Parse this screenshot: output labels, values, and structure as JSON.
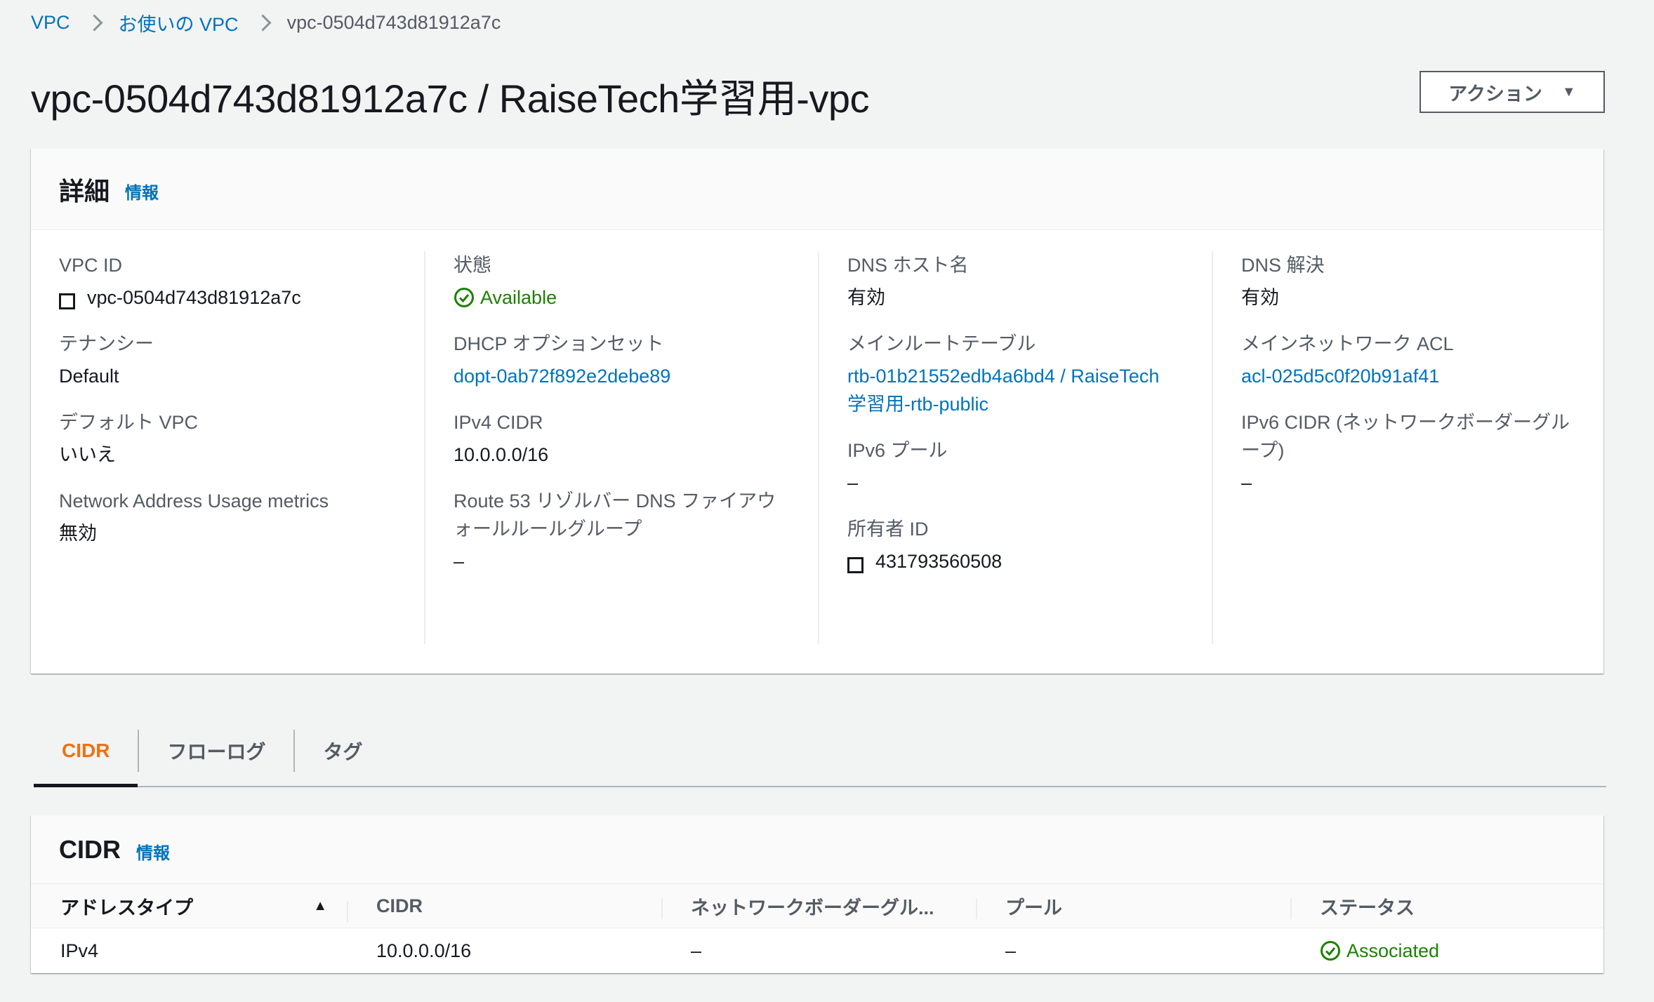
{
  "breadcrumb": {
    "items": [
      "VPC",
      "お使いの VPC"
    ],
    "current": "vpc-0504d743d81912a7c"
  },
  "page_title": "vpc-0504d743d81912a7c / RaiseTech学習用-vpc",
  "actions_button": {
    "label": "アクション",
    "caret": "▼"
  },
  "details": {
    "heading": "詳細",
    "info_link": "情報",
    "col1": {
      "vpc_id_label": "VPC ID",
      "vpc_id_value": "vpc-0504d743d81912a7c",
      "tenancy_label": "テナンシー",
      "tenancy_value": "Default",
      "default_vpc_label": "デフォルト VPC",
      "default_vpc_value": "いいえ",
      "nau_label": "Network Address Usage metrics",
      "nau_value": "無効"
    },
    "col2": {
      "state_label": "状態",
      "state_value": "Available",
      "dhcp_label": "DHCP オプションセット",
      "dhcp_value": "dopt-0ab72f892e2debe89",
      "ipv4_label": "IPv4 CIDR",
      "ipv4_value": "10.0.0.0/16",
      "route53_label_1": "Route 53 リゾルバー DNS ファイアウ",
      "route53_label_2": "ォールルールグループ",
      "route53_value": "–"
    },
    "col3": {
      "dns_host_label": "DNS ホスト名",
      "dns_host_value": "有効",
      "main_rt_label": "メインルートテーブル",
      "main_rt_value_1": "rtb-01b21552edb4a6bd4 / RaiseTech",
      "main_rt_value_2": "学習用-rtb-public",
      "ipv6_pool_label": "IPv6 プール",
      "ipv6_pool_value": "–",
      "owner_label": "所有者 ID",
      "owner_value": "431793560508"
    },
    "col4": {
      "dns_res_label": "DNS 解決",
      "dns_res_value": "有効",
      "main_acl_label": "メインネットワーク ACL",
      "main_acl_value": "acl-025d5c0f20b91af41",
      "ipv6_cidr_label_1": "IPv6 CIDR (ネットワークボーダーグル",
      "ipv6_cidr_label_2": "ープ)",
      "ipv6_cidr_value": "–"
    }
  },
  "tabs": [
    "CIDR",
    "フローログ",
    "タグ"
  ],
  "cidr_section": {
    "heading": "CIDR",
    "info_link": "情報",
    "columns": [
      "アドレスタイプ",
      "CIDR",
      "ネットワークボーダーグル...",
      "プール",
      "ステータス"
    ],
    "sort_icon": "▲",
    "rows": [
      {
        "address_type": "IPv4",
        "cidr": "10.0.0.0/16",
        "border_group": "–",
        "pool": "–",
        "status": "Associated"
      }
    ]
  },
  "colors": {
    "link": "#0073bb",
    "success": "#1d8102",
    "active_tab": "#ec7211",
    "background": "#f2f3f3"
  }
}
